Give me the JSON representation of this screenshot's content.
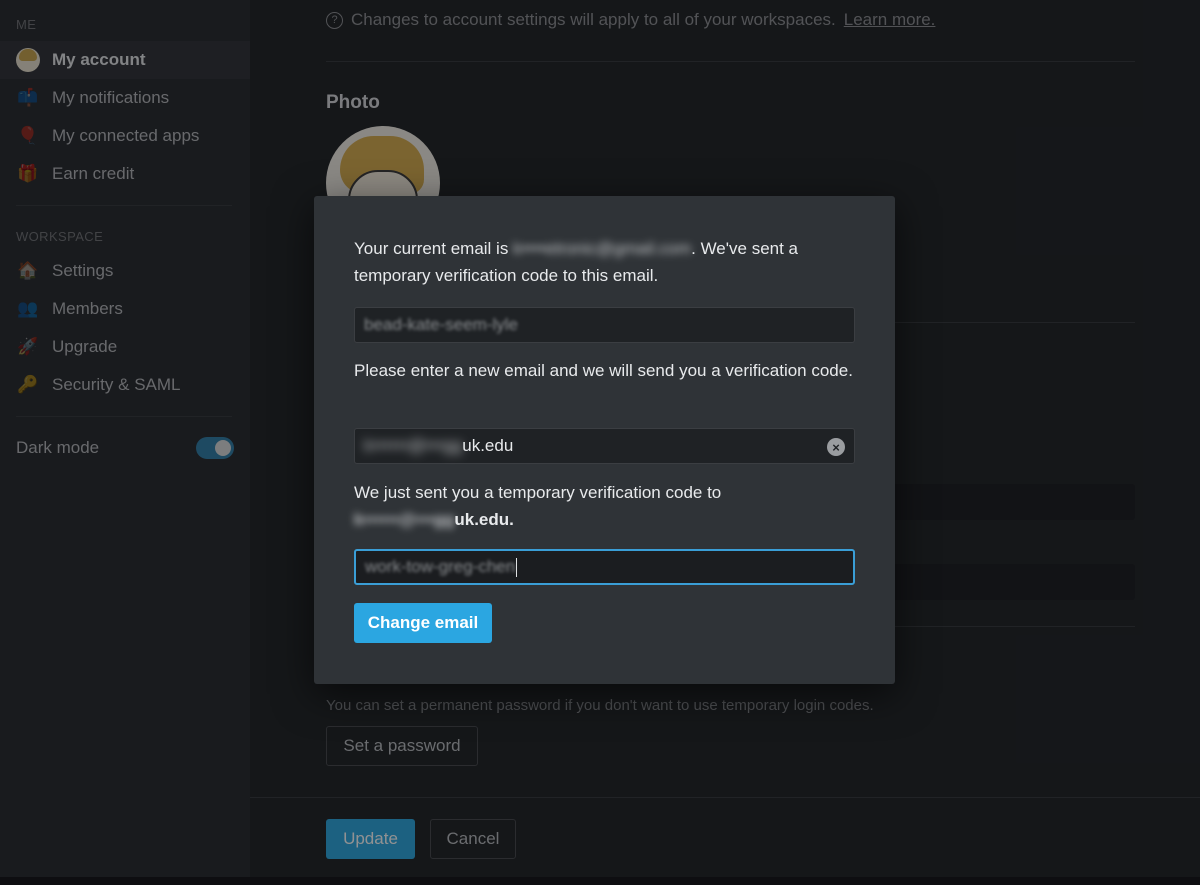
{
  "sidebar": {
    "me_label": "ME",
    "me_items": [
      {
        "label": "My account",
        "icon": "user-avatar-icon"
      },
      {
        "label": "My notifications",
        "icon": "mailbox-icon"
      },
      {
        "label": "My connected apps",
        "icon": "balloon-icon"
      },
      {
        "label": "Earn credit",
        "icon": "gift-icon"
      }
    ],
    "workspace_label": "WORKSPACE",
    "workspace_items": [
      {
        "label": "Settings",
        "icon": "house-icon"
      },
      {
        "label": "Members",
        "icon": "people-icon"
      },
      {
        "label": "Upgrade",
        "icon": "rocket-icon"
      },
      {
        "label": "Security & SAML",
        "icon": "key-icon"
      }
    ],
    "dark_mode_label": "Dark mode",
    "dark_mode_on": true
  },
  "main": {
    "info_text": "Changes to account settings will apply to all of your workspaces.",
    "learn_more": "Learn more.",
    "photo_title": "Photo",
    "password_note": "You can set a permanent password if you don't want to use temporary login codes.",
    "set_password_label": "Set a password",
    "update_label": "Update",
    "cancel_label": "Cancel"
  },
  "modal": {
    "current_email_prefix": "Your current email is",
    "current_email_redacted": "k••••etronic@gmail.com",
    "current_email_suffix": ". We've sent a temporary verification code to this email.",
    "code1_value": "bead-kate-seem-lyle",
    "new_email_prompt": "Please enter a new email and we will send you a verification code.",
    "new_email_redacted": "k••••••@•••gg",
    "new_email_visible": "uk.edu",
    "sent_prompt": "We just sent you a temporary verification code to",
    "sent_email_redacted": "k••••••@•••gg",
    "sent_email_visible": "uk.edu",
    "code2_value": "work-tow-greg-chen",
    "change_email_label": "Change email"
  },
  "colors": {
    "accent": "#2ba6e1",
    "background": "#1e2124",
    "sidebar": "#25282c",
    "modal": "#2f3337"
  }
}
